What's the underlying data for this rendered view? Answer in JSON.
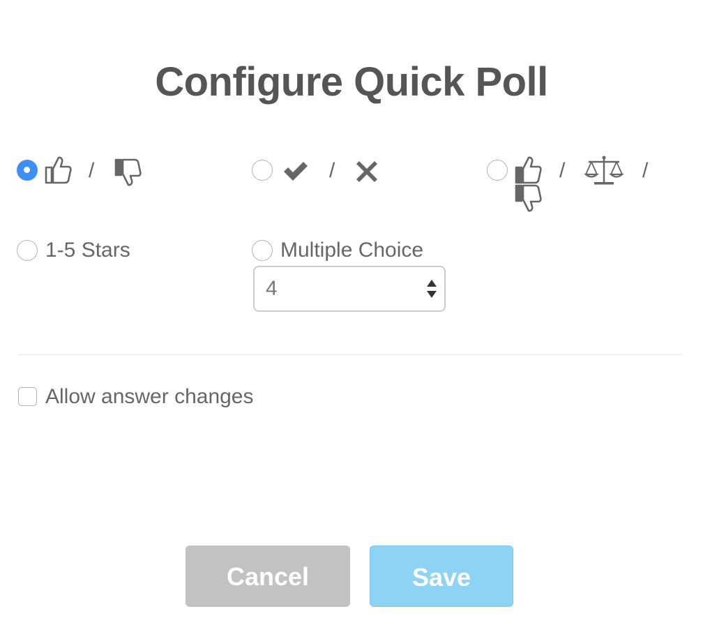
{
  "title": "Configure Quick Poll",
  "poll_types": [
    {
      "id": "thumbs",
      "icons": [
        "thumbs-up-icon",
        "thumbs-down-icon"
      ],
      "separator": "/",
      "selected": true
    },
    {
      "id": "check-x",
      "icons": [
        "check-icon",
        "x-icon"
      ],
      "separator": "/",
      "selected": false
    },
    {
      "id": "thumbs-neutral",
      "icons": [
        "thumbs-up-icon",
        "scale-icon",
        "thumbs-down-icon"
      ],
      "separator": "/",
      "selected": false
    },
    {
      "id": "stars",
      "label": "1-5 Stars",
      "selected": false
    },
    {
      "id": "multiple-choice",
      "label": "Multiple Choice",
      "selected": false
    }
  ],
  "multiple_choice_count": {
    "value": "4"
  },
  "allow_answer_changes": {
    "label": "Allow answer changes",
    "checked": false
  },
  "buttons": {
    "cancel": "Cancel",
    "save": "Save"
  },
  "colors": {
    "accent": "#3d8ff5",
    "cancel_bg": "#c2c2c2",
    "save_bg": "#8dd3f4",
    "text": "#666666",
    "title": "#555555"
  }
}
